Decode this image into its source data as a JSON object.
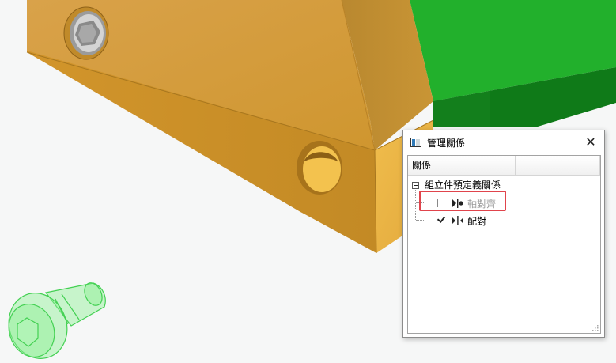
{
  "dialog": {
    "title": "管理關係",
    "close_glyph": "✕",
    "column_header": "關係",
    "tree": {
      "root_label": "組立件預定義關係",
      "items": [
        {
          "label": "軸對齊",
          "checked": false,
          "enabled": false,
          "icon": "axial-align-icon"
        },
        {
          "label": "配對",
          "checked": true,
          "enabled": true,
          "icon": "mate-icon"
        }
      ]
    }
  },
  "colors": {
    "part_orange": "#d8982f",
    "part_green": "#1f9d27",
    "ghost_screw": "#5fe06c",
    "highlight": "#e0444c",
    "disabled_text": "#9a9a9a"
  }
}
